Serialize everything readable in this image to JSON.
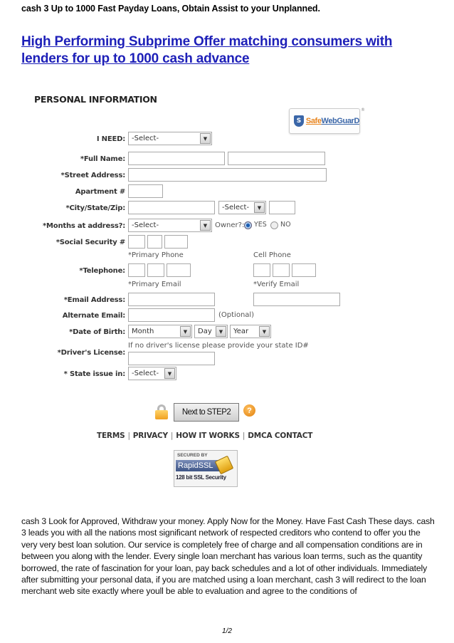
{
  "header": {
    "title": "cash 3 Up to 1000 Fast Payday Loans, Obtain Assist to your Unplanned."
  },
  "heading": {
    "link_text": "High Performing Subprime Offer matching consumers with lenders for up to 1000 cash advance "
  },
  "form": {
    "title": "PERSONAL INFORMATION",
    "badge": {
      "safe": "Safe",
      "web": "WebGuarD",
      "shield_letter": "S",
      "reg": "®"
    },
    "labels": {
      "i_need": "I NEED:",
      "full_name": "*Full Name:",
      "street": "*Street Address:",
      "apartment": "Apartment #",
      "city_state_zip": "*City/State/Zip:",
      "months": "*Months at address?:",
      "ssn": "*Social Security #",
      "telephone": "*Telephone:",
      "email": "*Email Address:",
      "alt_email": "Alternate Email:",
      "dob": "*Date of Birth:",
      "license": "*Driver's License:",
      "state_issue": "* State issue in:"
    },
    "selects": {
      "i_need": "-Select-",
      "state": "-Select-",
      "months": "-Select-",
      "dob_month": "Month",
      "dob_day": "Day",
      "dob_year": "Year",
      "state_issue": "-Select-"
    },
    "owner": {
      "label": "Owner?:",
      "yes": "YES",
      "no": "NO",
      "selected": "YES"
    },
    "sub_labels": {
      "primary_phone": "*Primary Phone",
      "cell_phone": "Cell Phone",
      "primary_email": "*Primary Email",
      "verify_email": "*Verify Email"
    },
    "notes": {
      "optional": "(Optional)",
      "license_hint": "If no driver's license please provide your state ID#"
    },
    "next_button": "Next to STEP2",
    "help_glyph": "?",
    "footer_links": [
      "TERMS",
      "PRIVACY",
      "HOW IT WORKS",
      "DMCA CONTACT"
    ],
    "footer_sep": "|",
    "ssl": {
      "top": "SECURED BY",
      "brand": "RapidSSL",
      "bottom": "128 bit SSL Security"
    }
  },
  "body_text": "cash 3 Look for Approved, Withdraw your money. Apply Now for the Money. Have Fast Cash These days. cash 3 leads you with all the nations most significant network of respected creditors who contend to offer you the very very best loan solution. Our service is completely free of charge and all compensation conditions are in between you along with the lender. Every single loan merchant has various loan terms, such as the quantity borrowed, the rate of fascination for your loan, pay back schedules and a lot of other individuals. Immediately after submitting your personal data, if you are matched using a loan merchant, cash 3 will redirect to the loan merchant web site exactly where youll be able to evaluation and agree to the conditions of",
  "page_number": "1/2"
}
